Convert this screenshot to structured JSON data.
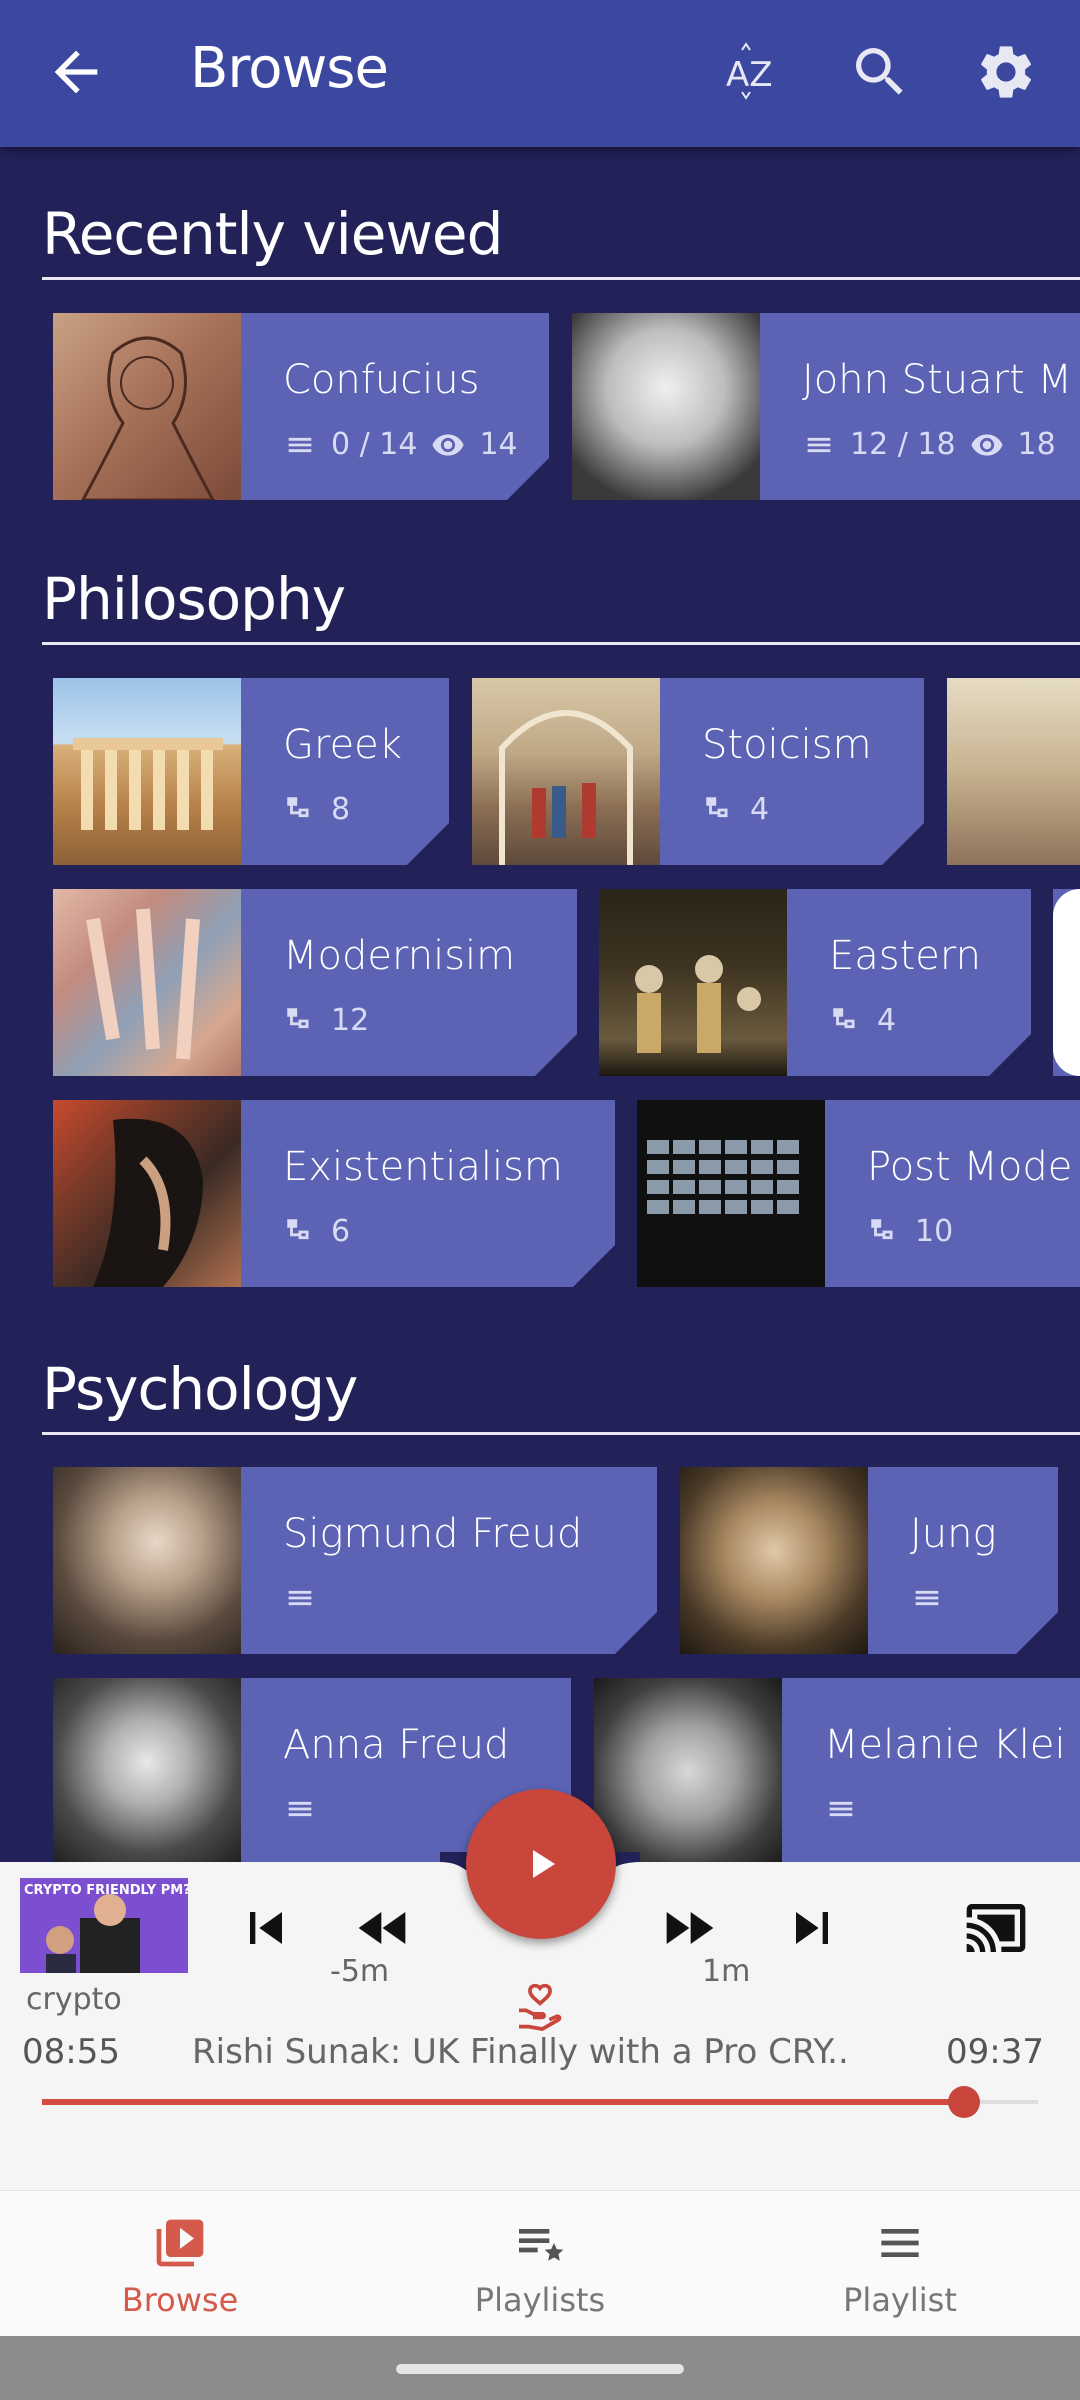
{
  "appbar": {
    "title": "Browse",
    "sort_icon_text": "AZ"
  },
  "sections": {
    "recent": {
      "title": "Recently viewed"
    },
    "philosophy": {
      "title": "Philosophy"
    },
    "psychology": {
      "title": "Psychology"
    }
  },
  "recent_cards": [
    {
      "name": "Confucius",
      "progress": "0 / 14",
      "views": "14"
    },
    {
      "name": "John Stuart M",
      "progress": "12 / 18",
      "views": "18"
    }
  ],
  "philosophy_cards": [
    {
      "name": "Greek",
      "count": "8"
    },
    {
      "name": "Stoicism",
      "count": "4"
    },
    {
      "name": "Modernisim",
      "count": "12"
    },
    {
      "name": "Eastern",
      "count": "4"
    },
    {
      "name": "Existentialism",
      "count": "6"
    },
    {
      "name": "Post Mode",
      "count": "10"
    }
  ],
  "psychology_cards": [
    {
      "name": "Sigmund Freud"
    },
    {
      "name": "Jung"
    },
    {
      "name": "Anna Freud"
    },
    {
      "name": "Melanie Klei"
    }
  ],
  "player": {
    "thumb_text": "CRYPTO FRIENDLY PM?!",
    "channel": "crypto",
    "rewind_label": "-5m",
    "forward_label": "1m",
    "elapsed": "08:55",
    "track_title": "Rishi Sunak: UK Finally with a Pro CRY..",
    "duration": "09:37",
    "progress_fraction": 0.926,
    "accent_color": "#c8463c"
  },
  "bottomnav": {
    "items": [
      {
        "label": "Browse",
        "active": true
      },
      {
        "label": "Playlists",
        "active": false
      },
      {
        "label": "Playlist",
        "active": false
      }
    ]
  }
}
